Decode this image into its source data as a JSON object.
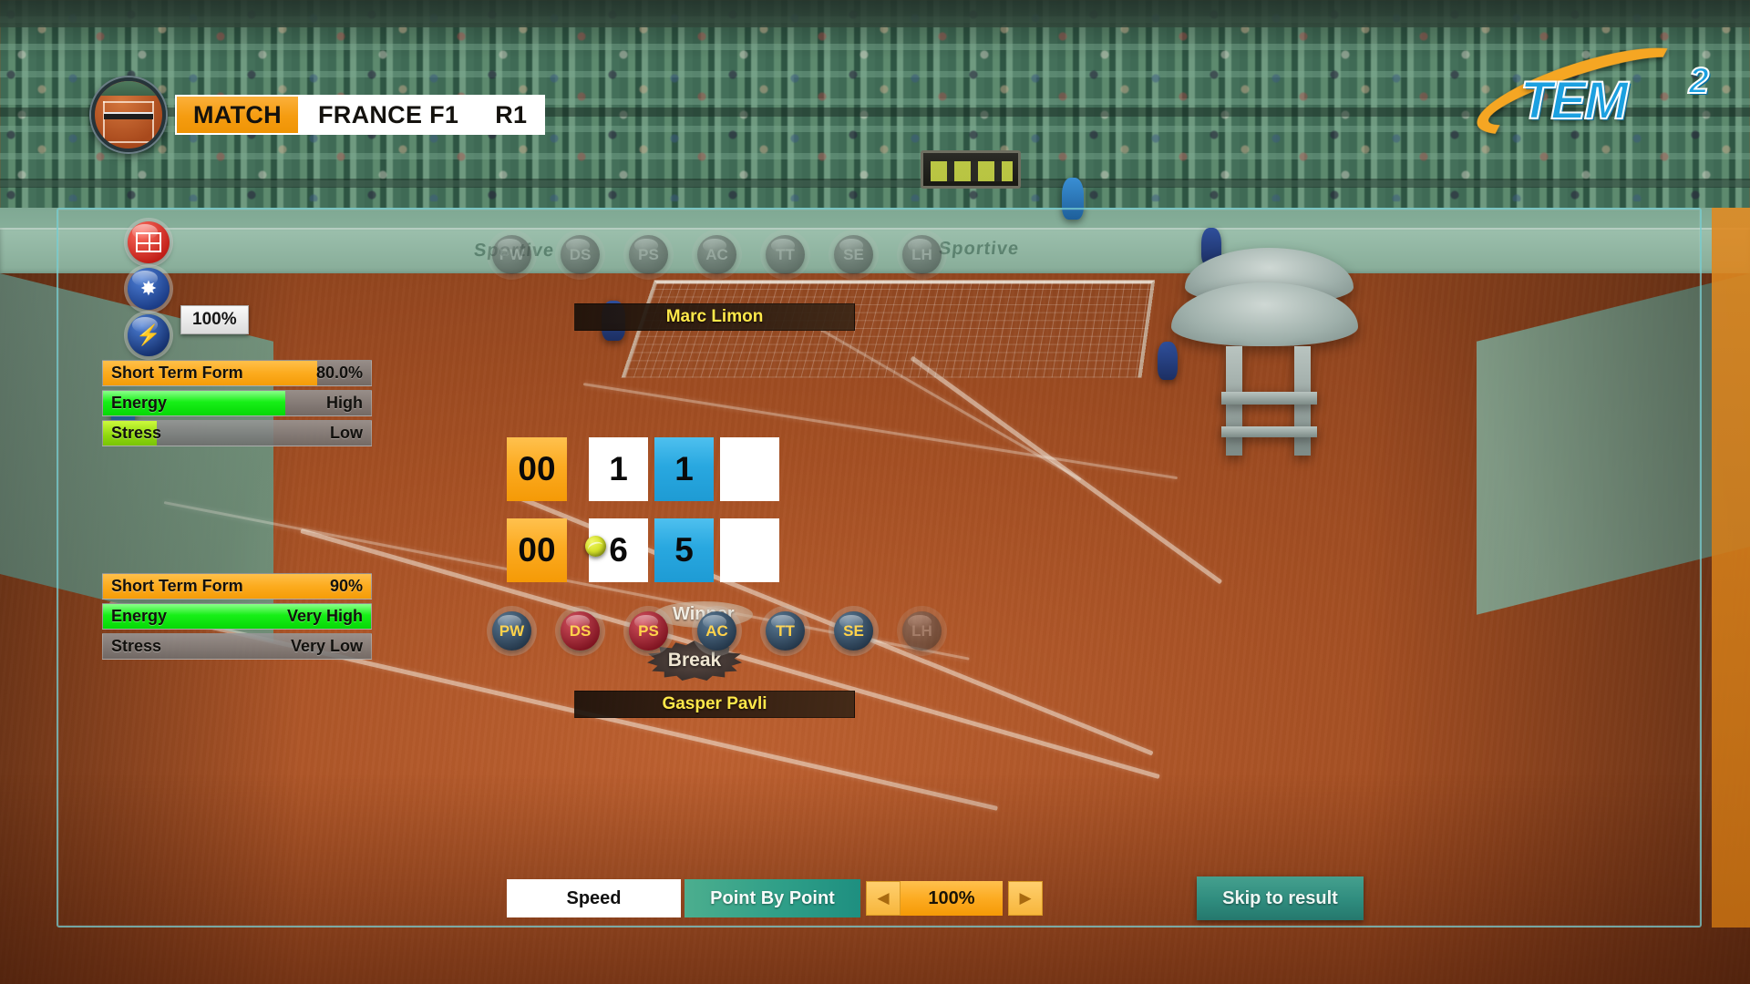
{
  "logo": {
    "name": "TEM",
    "superscript": "2"
  },
  "header": {
    "court_icon": "clay-court-icon",
    "breadcrumb": [
      {
        "label": "MATCH",
        "active": true
      },
      {
        "label": "FRANCE F1",
        "active": false
      },
      {
        "label": "R1",
        "active": false
      }
    ]
  },
  "conditions": {
    "icons": [
      {
        "name": "court-surface-icon",
        "color": "#c01d16"
      },
      {
        "name": "weather-sun-icon",
        "color": "#1b3c86"
      },
      {
        "name": "energy-bolt-icon",
        "color": "#15316f"
      }
    ],
    "energy_tag": "100%"
  },
  "players": {
    "top": {
      "name": "Marc Limon",
      "stats": [
        {
          "label": "Short Term Form",
          "value": "80.0%",
          "percent": 80,
          "fill": "orange"
        },
        {
          "label": "Energy",
          "value": "High",
          "percent": 68,
          "fill": "green"
        },
        {
          "label": "Stress",
          "value": "Low",
          "percent": 20,
          "fill": "yellowgreen"
        }
      ]
    },
    "bottom": {
      "name": "Gasper Pavli",
      "stats": [
        {
          "label": "Short Term Form",
          "value": "90%",
          "percent": 100,
          "fill": "orange"
        },
        {
          "label": "Energy",
          "value": "Very High",
          "percent": 100,
          "fill": "green"
        },
        {
          "label": "Stress",
          "value": "Very Low",
          "percent": 0,
          "fill": "yellowgreen"
        }
      ]
    }
  },
  "shot_buttons": {
    "top_row": [
      {
        "code": "PW",
        "style": "dim"
      },
      {
        "code": "DS",
        "style": "dim"
      },
      {
        "code": "PS",
        "style": "dim"
      },
      {
        "code": "AC",
        "style": "dim"
      },
      {
        "code": "TT",
        "style": "dim"
      },
      {
        "code": "SE",
        "style": "dim"
      },
      {
        "code": "LH",
        "style": "dim"
      }
    ],
    "bottom_row": [
      {
        "code": "PW",
        "style": "blue"
      },
      {
        "code": "DS",
        "style": "red"
      },
      {
        "code": "PS",
        "style": "red"
      },
      {
        "code": "AC",
        "style": "blue"
      },
      {
        "code": "TT",
        "style": "blue"
      },
      {
        "code": "SE",
        "style": "blue"
      },
      {
        "code": "LH",
        "style": "dim"
      }
    ]
  },
  "scoreboard": {
    "rows": [
      {
        "player": "top",
        "points": "00",
        "sets": [
          "1",
          "1",
          ""
        ]
      },
      {
        "player": "bottom",
        "points": "00",
        "sets": [
          "6",
          "5",
          ""
        ]
      }
    ],
    "serving_row": "bottom",
    "winner_label": "Winner",
    "break_label": "Break"
  },
  "controls": {
    "speed_label": "Speed",
    "mode_label": "Point By Point",
    "prev_arrow": "◀",
    "next_arrow": "▶",
    "zoom_percent": "100%",
    "skip_label": "Skip to result"
  },
  "colors": {
    "accent_orange": "#f59c10",
    "accent_blue": "#29a8e0",
    "accent_teal": "#2f8c7e",
    "name_yellow": "#ffe84a",
    "clay": "#b4561f"
  }
}
